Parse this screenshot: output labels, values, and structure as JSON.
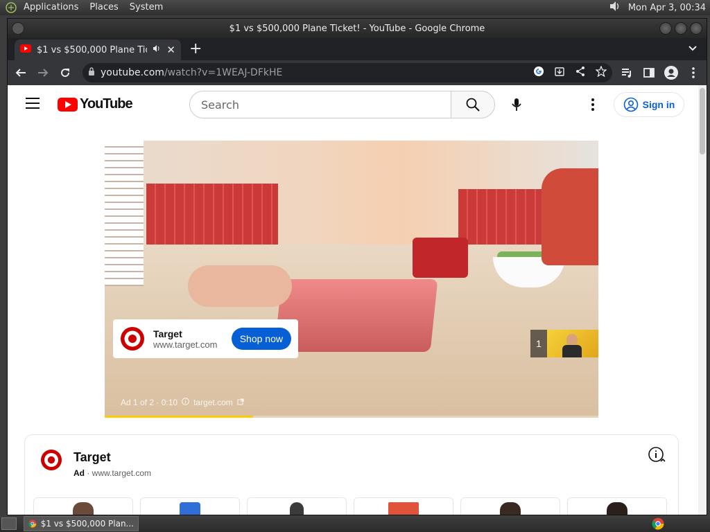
{
  "top_panel": {
    "menus": [
      "Applications",
      "Places",
      "System"
    ],
    "clock": "Mon Apr  3, 00:34"
  },
  "window": {
    "title": "$1 vs $500,000 Plane Ticket! - YouTube - Google Chrome"
  },
  "browser": {
    "tab_title": "$1 vs $500,000 Plane Tick",
    "url_host": "youtube.com",
    "url_path": "/watch?v=1WEAJ-DFkHE"
  },
  "youtube": {
    "logo_text": "YouTube",
    "search_placeholder": "Search",
    "sign_in_label": "Sign in"
  },
  "player": {
    "ad_card": {
      "advertiser": "Target",
      "url": "www.target.com",
      "cta": "Shop now"
    },
    "up_next_count": "1",
    "ad_info": {
      "position": "Ad 1 of 2 · 0:10",
      "domain": "target.com"
    },
    "ad_progress_fraction": 0.3
  },
  "companion": {
    "advertiser": "Target",
    "ad_label": "Ad",
    "url": "· www.target.com"
  },
  "taskbar": {
    "window_label": "$1 vs $500,000 Plan..."
  },
  "colors": {
    "youtube_red": "#ff0000",
    "link_blue": "#065fd4",
    "target_red": "#cc0000",
    "ad_progress": "#ffcc00"
  }
}
